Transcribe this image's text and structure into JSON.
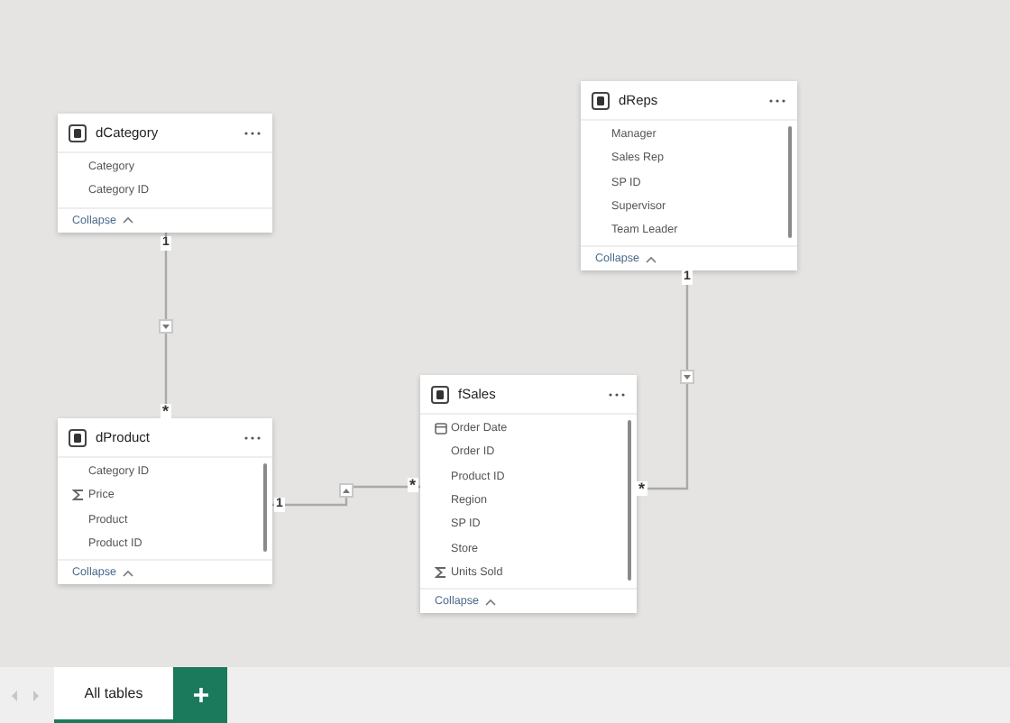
{
  "tables": [
    {
      "name": "dCategory",
      "scrollable": false,
      "fields": [
        {
          "name": "Category",
          "kind": "plain"
        },
        {
          "name": "Category ID",
          "kind": "plain"
        }
      ],
      "collapse": "Collapse"
    },
    {
      "name": "dReps",
      "scrollable": true,
      "fields": [
        {
          "name": "Manager",
          "kind": "plain"
        },
        {
          "name": "Sales Rep",
          "kind": "plain"
        },
        {
          "name": "SP ID",
          "kind": "plain"
        },
        {
          "name": "Supervisor",
          "kind": "plain"
        },
        {
          "name": "Team Leader",
          "kind": "plain"
        }
      ],
      "collapse": "Collapse"
    },
    {
      "name": "dProduct",
      "scrollable": true,
      "fields": [
        {
          "name": "Category ID",
          "kind": "plain"
        },
        {
          "name": "Price",
          "kind": "measure"
        },
        {
          "name": "Product",
          "kind": "plain"
        },
        {
          "name": "Product ID",
          "kind": "plain"
        }
      ],
      "collapse": "Collapse"
    },
    {
      "name": "fSales",
      "scrollable": true,
      "fields": [
        {
          "name": "Order Date",
          "kind": "date"
        },
        {
          "name": "Order ID",
          "kind": "plain"
        },
        {
          "name": "Product ID",
          "kind": "plain"
        },
        {
          "name": "Region",
          "kind": "plain"
        },
        {
          "name": "SP ID",
          "kind": "plain"
        },
        {
          "name": "Store",
          "kind": "plain"
        },
        {
          "name": "Units Sold",
          "kind": "measure"
        }
      ],
      "collapse": "Collapse"
    }
  ],
  "relationships": [
    {
      "one_label": "1",
      "many_label": "*"
    },
    {
      "one_label": "1",
      "many_label": "*"
    },
    {
      "one_label": "1",
      "many_label": "*"
    }
  ],
  "tabs": [
    {
      "label": "All tables",
      "selected": true
    }
  ]
}
